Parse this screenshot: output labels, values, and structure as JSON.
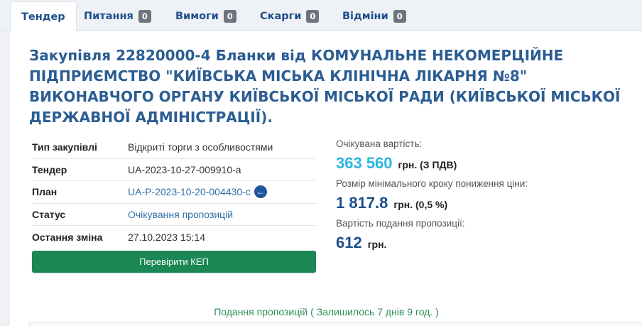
{
  "tabs": [
    {
      "label": "Тендер",
      "badge": null
    },
    {
      "label": "Питання",
      "badge": "0"
    },
    {
      "label": "Вимоги",
      "badge": "0"
    },
    {
      "label": "Скарги",
      "badge": "0"
    },
    {
      "label": "Відміни",
      "badge": "0"
    }
  ],
  "title": "Закупівля 22820000-4 Бланки від КОМУНАЛЬНЕ НЕКОМЕРЦІЙНЕ ПІДПРИЄМСТВО \"КИЇВСЬКА МІСЬКА КЛІНІЧНА ЛІКАРНЯ №8\" ВИКОНАВЧОГО ОРГАНУ КИЇВСЬКОЇ МІСЬКОЇ РАДИ (КИЇВСЬКОЇ МІСЬКОЇ ДЕРЖАВНОЇ АДМІНІСТРАЦІЇ).",
  "info": {
    "type_label": "Тип закупівлі",
    "type_value": "Відкриті торги з особливостями",
    "tender_label": "Тендер",
    "tender_value": "UA-2023-10-27-009910-a",
    "plan_label": "План",
    "plan_value": "UA-P-2023-10-20-004430-c",
    "status_label": "Статус",
    "status_value": "Очікування пропозицій",
    "changed_label": "Остання зміна",
    "changed_value": "27.10.2023 15:14"
  },
  "kep_button": "Перевірити КЕП",
  "price": {
    "expected_label": "Очікувана вартість:",
    "expected_value": "363 560",
    "expected_unit": "грн. (З ПДВ)",
    "step_label": "Розмір мінімального кроку пониження ціни:",
    "step_value": "1 817.8",
    "step_unit": "грн. (0,5 %)",
    "fee_label": "Вартість подання пропозиції:",
    "fee_value": "612",
    "fee_unit": "грн."
  },
  "status_line": "Подання пропозицій ( Залишилось 7 днів 9 год. )",
  "icons": {
    "plan_link": "arrow-left-circle-icon"
  },
  "colors": {
    "accent": "#2b5d93",
    "button": "#1b8754",
    "highlight": "#2bb6e0",
    "badge": "#6c757d"
  }
}
